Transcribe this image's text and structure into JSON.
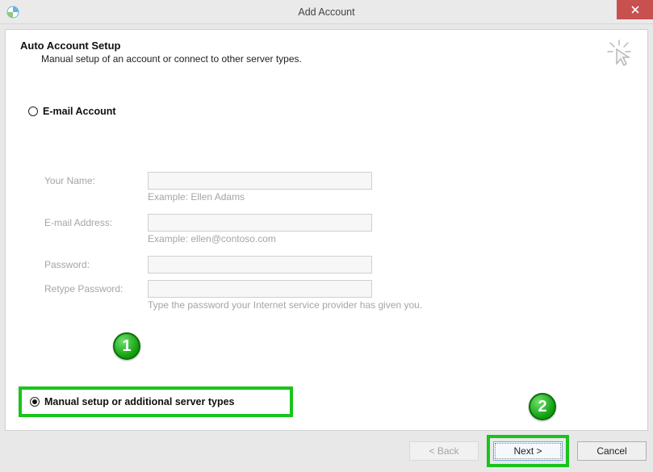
{
  "window": {
    "title": "Add Account"
  },
  "header": {
    "title": "Auto Account Setup",
    "subtitle": "Manual setup of an account or connect to other server types."
  },
  "radios": {
    "email": {
      "label": "E-mail Account",
      "selected": false
    },
    "manual": {
      "label": "Manual setup or additional server types",
      "selected": true
    }
  },
  "form": {
    "name": {
      "label": "Your Name:",
      "value": "",
      "hint": "Example: Ellen Adams"
    },
    "email": {
      "label": "E-mail Address:",
      "value": "",
      "hint": "Example: ellen@contoso.com"
    },
    "password": {
      "label": "Password:",
      "value": ""
    },
    "retype": {
      "label": "Retype Password:",
      "value": "",
      "hint": "Type the password your Internet service provider has given you."
    }
  },
  "buttons": {
    "back": "< Back",
    "next": "Next >",
    "cancel": "Cancel"
  },
  "annotations": {
    "badge1": "1",
    "badge2": "2"
  }
}
